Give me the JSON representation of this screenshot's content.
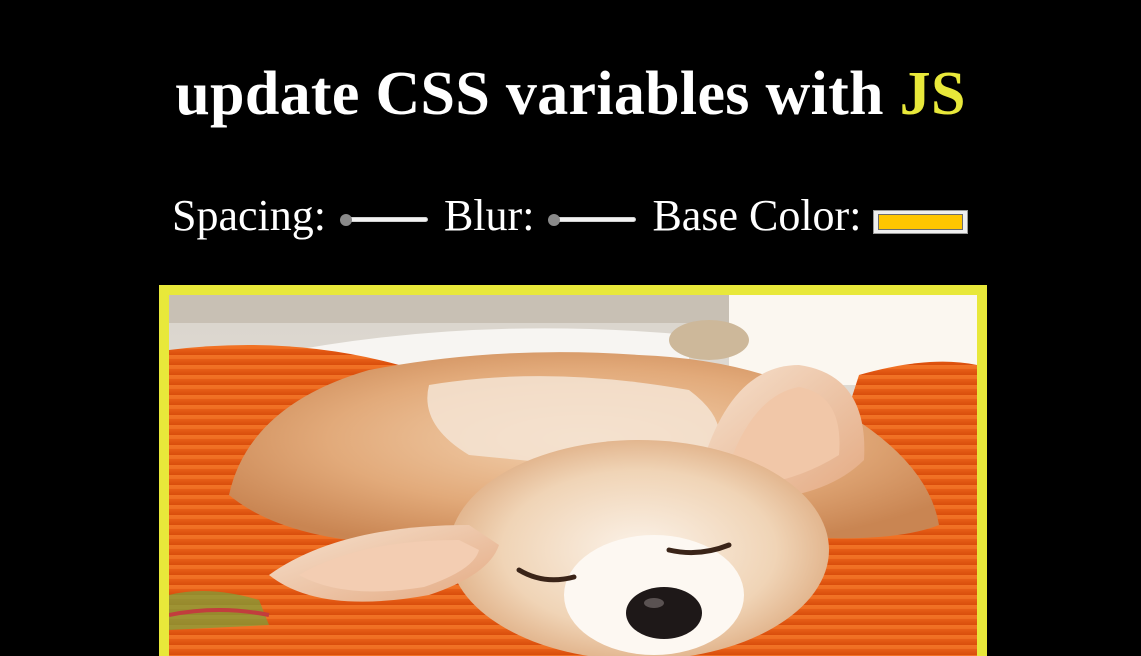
{
  "header": {
    "title_main": "update CSS variables with",
    "title_highlight": "JS"
  },
  "controls": {
    "spacing_label": "Spacing:",
    "spacing_value": 10,
    "spacing_min": 10,
    "spacing_max": 200,
    "blur_label": "Blur:",
    "blur_value": 0,
    "blur_min": 0,
    "blur_max": 25,
    "base_color_label": "Base Color:",
    "base_color_value": "#ffc600"
  },
  "photo": {
    "subject": "sleeping corgi on orange cushion"
  },
  "colors": {
    "background": "#000000",
    "text": "#ffffff",
    "highlight": "#e8e83a",
    "frame": "#e8e83a"
  }
}
